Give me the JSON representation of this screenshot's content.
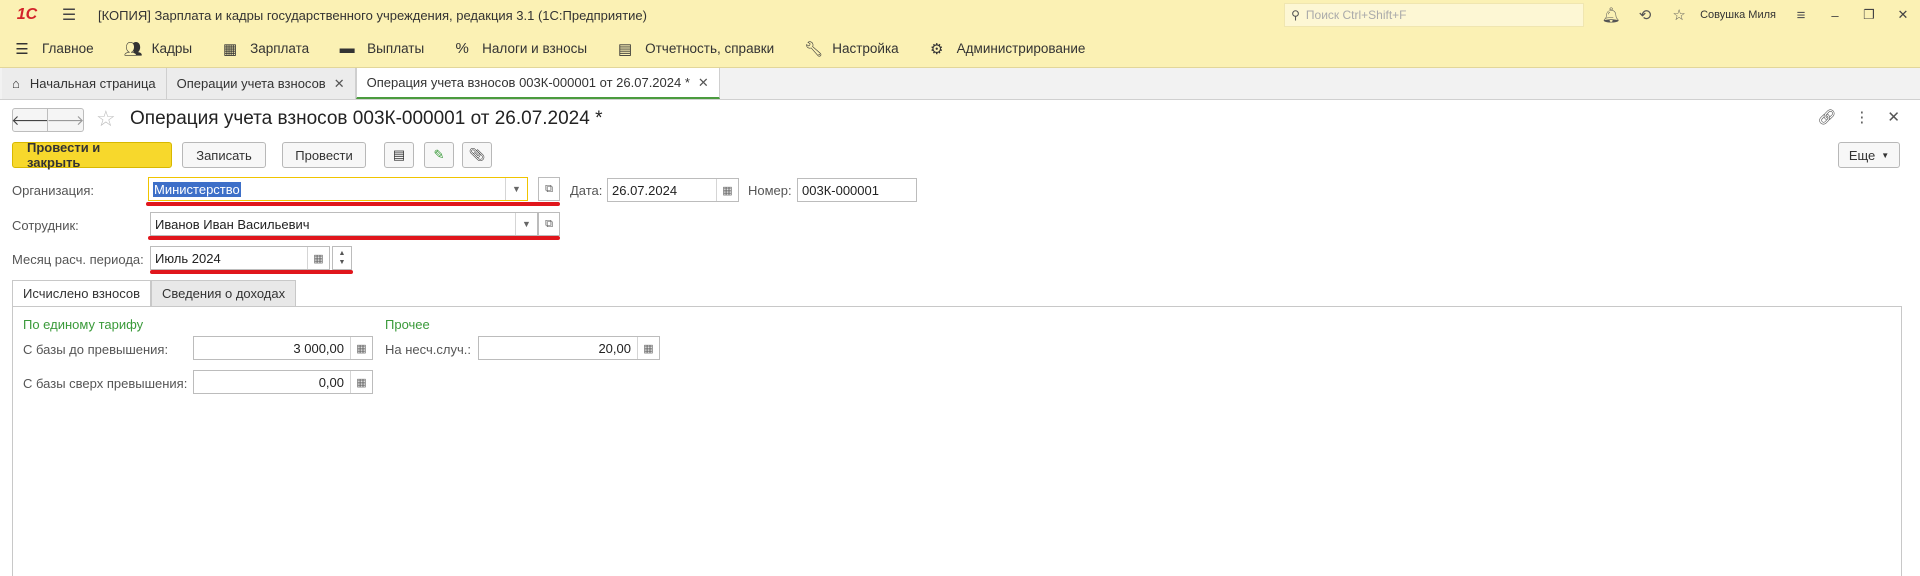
{
  "titlebar": {
    "logo": "1С",
    "title": "[КОПИЯ] Зарплата и кадры государственного учреждения, редакция 3.1  (1С:Предприятие)",
    "search_placeholder": "Поиск Ctrl+Shift+F",
    "username": "Совушка Миля"
  },
  "menu": {
    "items": [
      {
        "label": "Главное",
        "icon": "menu-lines-icon"
      },
      {
        "label": "Кадры",
        "icon": "people-icon"
      },
      {
        "label": "Зарплата",
        "icon": "calculator-icon"
      },
      {
        "label": "Выплаты",
        "icon": "wallet-icon"
      },
      {
        "label": "Налоги и взносы",
        "icon": "percent-icon"
      },
      {
        "label": "Отчетность, справки",
        "icon": "reports-icon"
      },
      {
        "label": "Настройка",
        "icon": "wrench-icon"
      },
      {
        "label": "Администрирование",
        "icon": "gear-icon"
      }
    ]
  },
  "tabs": [
    {
      "label": "Начальная страница"
    },
    {
      "label": "Операции учета взносов"
    },
    {
      "label": "Операция учета взносов 003К-000001 от 26.07.2024 *"
    }
  ],
  "document": {
    "title": "Операция учета взносов 003К-000001 от 26.07.2024 *"
  },
  "toolbar": {
    "post_close": "Провести и закрыть",
    "save": "Записать",
    "post": "Провести",
    "more": "Еще"
  },
  "form": {
    "org_label": "Организация:",
    "org_value": "Министерство",
    "date_label": "Дата:",
    "date_value": "26.07.2024",
    "number_label": "Номер:",
    "number_value": "003К-000001",
    "employee_label": "Сотрудник:",
    "employee_value": "Иванов Иван Васильевич",
    "month_label": "Месяц расч. периода:",
    "month_value": "Июль 2024"
  },
  "inner_tabs": [
    {
      "label": "Исчислено взносов"
    },
    {
      "label": "Сведения о доходах"
    }
  ],
  "contrib": {
    "single_rate_title": "По единому тарифу",
    "base_below_label": "С базы до превышения:",
    "base_below_value": "3 000,00",
    "base_above_label": "С базы сверх превышения:",
    "base_above_value": "0,00",
    "other_title": "Прочее",
    "accident_label": "На несч.случ.:",
    "accident_value": "20,00"
  }
}
